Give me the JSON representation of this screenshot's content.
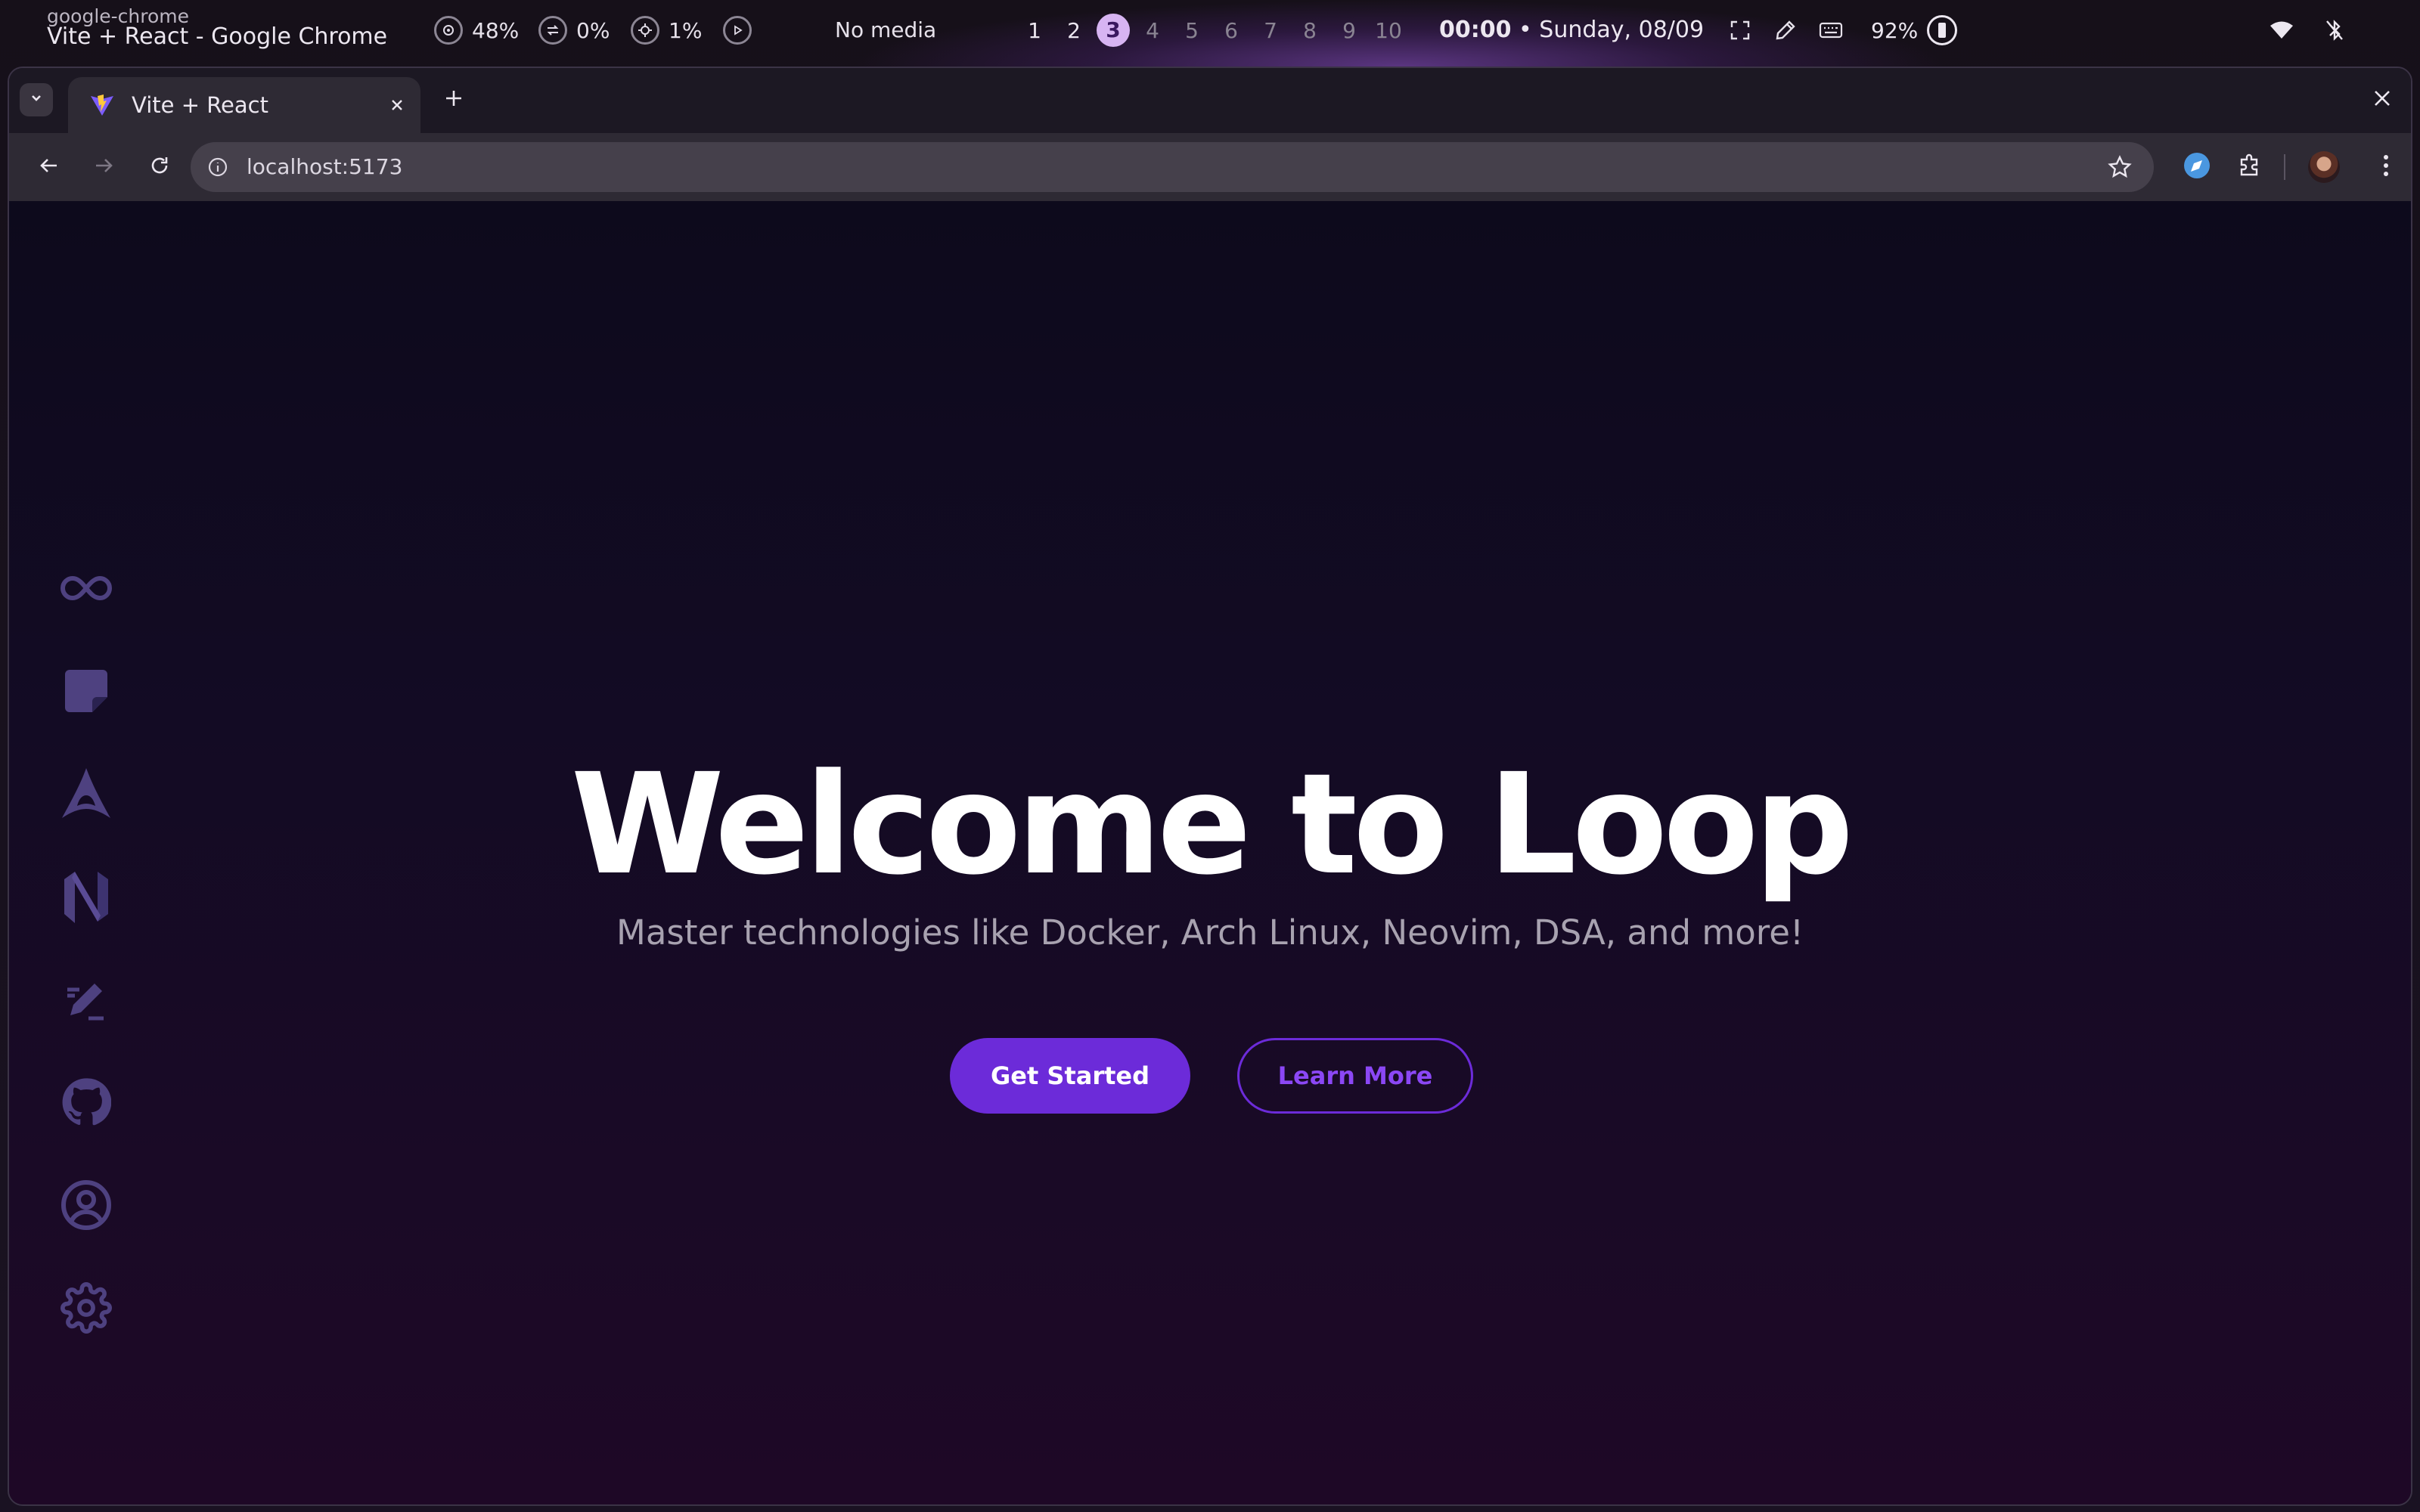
{
  "topbar": {
    "window_class": "google-chrome",
    "window_title": "Vite + React - Google Chrome",
    "resources": [
      {
        "icon": "cpu-icon",
        "value": "48%"
      },
      {
        "icon": "swap-icon",
        "value": "0%"
      },
      {
        "icon": "gpu-icon",
        "value": "1%"
      }
    ],
    "media_play_icon": "play-icon",
    "media_label": "No media",
    "workspaces": [
      "1",
      "2",
      "3",
      "4",
      "5",
      "6",
      "7",
      "8",
      "9",
      "10"
    ],
    "active_workspace": "3",
    "occupied_workspaces": [
      "1",
      "2",
      "3"
    ],
    "time": "00:00",
    "date": "• Sunday, 08/09",
    "tray_icons": [
      "screenshot-region-icon",
      "color-picker-icon",
      "keyboard-icon"
    ],
    "battery": "92%",
    "status_icons": [
      "wifi-icon",
      "bluetooth-off-icon"
    ]
  },
  "browser": {
    "tab_title": "Vite + React",
    "url": "localhost:5173",
    "colors": {
      "frame": "#1c1823",
      "toolbar": "#2e2a34",
      "omnibox": "#45404b"
    }
  },
  "page": {
    "sidebar_icons": [
      "infinity-icon",
      "sticky-note-icon",
      "arch-linux-icon",
      "neovim-icon",
      "edit-pencil-icon",
      "github-icon",
      "user-circle-icon",
      "settings-gear-icon"
    ],
    "title": "Welcome to Loop",
    "subtitle": "Master technologies like Docker, Arch Linux, Neovim, DSA, and more!",
    "primary_button": "Get Started",
    "secondary_button": "Learn More",
    "colors": {
      "accent": "#6c2bd9",
      "sidebar_icon": "#4e4180",
      "background_top": "#0d0a1c",
      "background_bottom": "#1e0826"
    }
  }
}
